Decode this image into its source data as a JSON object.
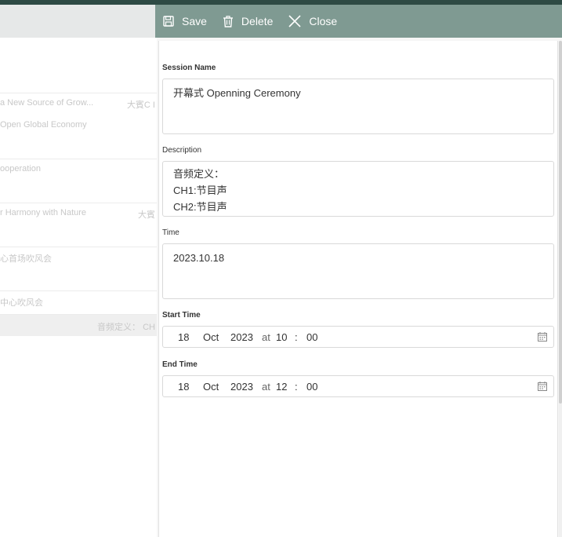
{
  "background_list": {
    "rows": [
      {
        "line1": "a New Source of Grow...",
        "right": "大賓C I",
        "line2": "Open Global Economy"
      },
      {
        "line1": "ooperation",
        "right": "",
        "line2": ""
      },
      {
        "line1": "r Harmony with Nature",
        "right": "大賓",
        "line2": ""
      },
      {
        "line1": "心首场吹风会",
        "right": "",
        "line2": ""
      },
      {
        "line1": "中心吹风会",
        "right": "",
        "line2": ""
      }
    ],
    "selected_row": {
      "right": "音频定义： CH"
    }
  },
  "toolbar": {
    "save_label": "Save",
    "delete_label": "Delete",
    "close_label": "Close"
  },
  "form": {
    "session_name": {
      "label": "Session Name",
      "value": "开幕式 Openning Ceremony"
    },
    "description": {
      "label": "Description",
      "lines": [
        "音频定义：",
        "CH1:节目声",
        "CH2:节目声"
      ]
    },
    "time": {
      "label": "Time",
      "value": "2023.10.18"
    },
    "start_time": {
      "label": "Start Time",
      "day": "18",
      "month": "Oct",
      "year": "2023",
      "at": "at",
      "hour": "10",
      "sep": ":",
      "minute": "00"
    },
    "end_time": {
      "label": "End Time",
      "day": "18",
      "month": "Oct",
      "year": "2023",
      "at": "at",
      "hour": "12",
      "sep": ":",
      "minute": "00"
    }
  },
  "icons": {
    "save": "floppy-disk-icon",
    "delete": "trash-icon",
    "close": "close-icon",
    "calendar": "calendar-icon"
  },
  "colors": {
    "toolbar_bg": "#7f9a92",
    "top_band": "#2e4a44"
  }
}
